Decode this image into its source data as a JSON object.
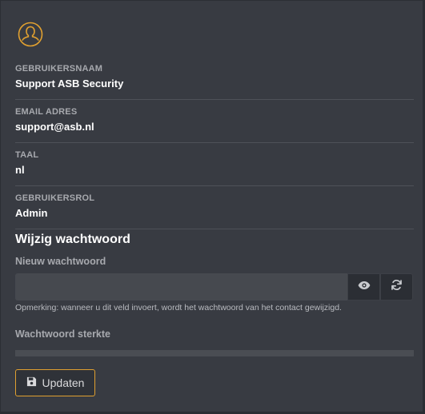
{
  "profile": {
    "avatar_icon": "user-circle-icon",
    "accent_color": "#e0a030"
  },
  "fields": [
    {
      "label": "GEBRUIKERSNAAM",
      "value": "Support ASB Security"
    },
    {
      "label": "EMAIL ADRES",
      "value": "support@asb.nl"
    },
    {
      "label": "TAAL",
      "value": "nl"
    },
    {
      "label": "GEBRUIKERSROL",
      "value": "Admin"
    }
  ],
  "password_section": {
    "title": "Wijzig wachtwoord",
    "new_password_label": "Nieuw wachtwoord",
    "new_password_value": "",
    "show_icon": "eye-icon",
    "generate_icon": "refresh-icon",
    "remark": "Opmerking: wanneer u dit veld invoert, wordt het wachtwoord van het contact gewijzigd.",
    "strength_label": "Wachtwoord sterkte",
    "strength_fraction": 0
  },
  "actions": {
    "update_label": "Updaten",
    "update_icon": "save-icon"
  }
}
